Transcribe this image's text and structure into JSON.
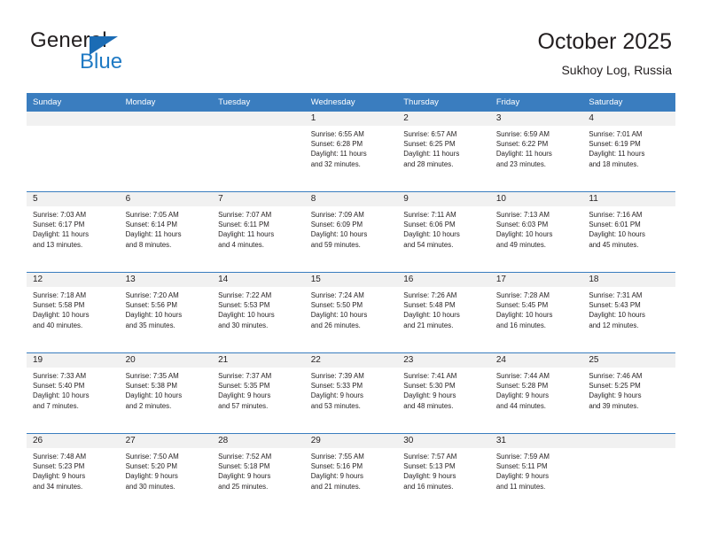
{
  "brand": {
    "name_top": "General",
    "name_bottom": "Blue",
    "triangle_color": "#1b6cb5",
    "blue_color": "#1f7ac4"
  },
  "header": {
    "title": "October 2025",
    "subtitle": "Sukhoy Log, Russia",
    "accent_color": "#3a7dbf",
    "daynum_band_color": "#f1f1f1"
  },
  "weekday_headers": [
    "Sunday",
    "Monday",
    "Tuesday",
    "Wednesday",
    "Thursday",
    "Friday",
    "Saturday"
  ],
  "weeks": [
    [
      {
        "day": "",
        "sunrise": "",
        "sunset": "",
        "daylight_line1": "",
        "daylight_line2": ""
      },
      {
        "day": "",
        "sunrise": "",
        "sunset": "",
        "daylight_line1": "",
        "daylight_line2": ""
      },
      {
        "day": "",
        "sunrise": "",
        "sunset": "",
        "daylight_line1": "",
        "daylight_line2": ""
      },
      {
        "day": "1",
        "sunrise": "Sunrise: 6:55 AM",
        "sunset": "Sunset: 6:28 PM",
        "daylight_line1": "Daylight: 11 hours",
        "daylight_line2": "and 32 minutes."
      },
      {
        "day": "2",
        "sunrise": "Sunrise: 6:57 AM",
        "sunset": "Sunset: 6:25 PM",
        "daylight_line1": "Daylight: 11 hours",
        "daylight_line2": "and 28 minutes."
      },
      {
        "day": "3",
        "sunrise": "Sunrise: 6:59 AM",
        "sunset": "Sunset: 6:22 PM",
        "daylight_line1": "Daylight: 11 hours",
        "daylight_line2": "and 23 minutes."
      },
      {
        "day": "4",
        "sunrise": "Sunrise: 7:01 AM",
        "sunset": "Sunset: 6:19 PM",
        "daylight_line1": "Daylight: 11 hours",
        "daylight_line2": "and 18 minutes."
      }
    ],
    [
      {
        "day": "5",
        "sunrise": "Sunrise: 7:03 AM",
        "sunset": "Sunset: 6:17 PM",
        "daylight_line1": "Daylight: 11 hours",
        "daylight_line2": "and 13 minutes."
      },
      {
        "day": "6",
        "sunrise": "Sunrise: 7:05 AM",
        "sunset": "Sunset: 6:14 PM",
        "daylight_line1": "Daylight: 11 hours",
        "daylight_line2": "and 8 minutes."
      },
      {
        "day": "7",
        "sunrise": "Sunrise: 7:07 AM",
        "sunset": "Sunset: 6:11 PM",
        "daylight_line1": "Daylight: 11 hours",
        "daylight_line2": "and 4 minutes."
      },
      {
        "day": "8",
        "sunrise": "Sunrise: 7:09 AM",
        "sunset": "Sunset: 6:09 PM",
        "daylight_line1": "Daylight: 10 hours",
        "daylight_line2": "and 59 minutes."
      },
      {
        "day": "9",
        "sunrise": "Sunrise: 7:11 AM",
        "sunset": "Sunset: 6:06 PM",
        "daylight_line1": "Daylight: 10 hours",
        "daylight_line2": "and 54 minutes."
      },
      {
        "day": "10",
        "sunrise": "Sunrise: 7:13 AM",
        "sunset": "Sunset: 6:03 PM",
        "daylight_line1": "Daylight: 10 hours",
        "daylight_line2": "and 49 minutes."
      },
      {
        "day": "11",
        "sunrise": "Sunrise: 7:16 AM",
        "sunset": "Sunset: 6:01 PM",
        "daylight_line1": "Daylight: 10 hours",
        "daylight_line2": "and 45 minutes."
      }
    ],
    [
      {
        "day": "12",
        "sunrise": "Sunrise: 7:18 AM",
        "sunset": "Sunset: 5:58 PM",
        "daylight_line1": "Daylight: 10 hours",
        "daylight_line2": "and 40 minutes."
      },
      {
        "day": "13",
        "sunrise": "Sunrise: 7:20 AM",
        "sunset": "Sunset: 5:56 PM",
        "daylight_line1": "Daylight: 10 hours",
        "daylight_line2": "and 35 minutes."
      },
      {
        "day": "14",
        "sunrise": "Sunrise: 7:22 AM",
        "sunset": "Sunset: 5:53 PM",
        "daylight_line1": "Daylight: 10 hours",
        "daylight_line2": "and 30 minutes."
      },
      {
        "day": "15",
        "sunrise": "Sunrise: 7:24 AM",
        "sunset": "Sunset: 5:50 PM",
        "daylight_line1": "Daylight: 10 hours",
        "daylight_line2": "and 26 minutes."
      },
      {
        "day": "16",
        "sunrise": "Sunrise: 7:26 AM",
        "sunset": "Sunset: 5:48 PM",
        "daylight_line1": "Daylight: 10 hours",
        "daylight_line2": "and 21 minutes."
      },
      {
        "day": "17",
        "sunrise": "Sunrise: 7:28 AM",
        "sunset": "Sunset: 5:45 PM",
        "daylight_line1": "Daylight: 10 hours",
        "daylight_line2": "and 16 minutes."
      },
      {
        "day": "18",
        "sunrise": "Sunrise: 7:31 AM",
        "sunset": "Sunset: 5:43 PM",
        "daylight_line1": "Daylight: 10 hours",
        "daylight_line2": "and 12 minutes."
      }
    ],
    [
      {
        "day": "19",
        "sunrise": "Sunrise: 7:33 AM",
        "sunset": "Sunset: 5:40 PM",
        "daylight_line1": "Daylight: 10 hours",
        "daylight_line2": "and 7 minutes."
      },
      {
        "day": "20",
        "sunrise": "Sunrise: 7:35 AM",
        "sunset": "Sunset: 5:38 PM",
        "daylight_line1": "Daylight: 10 hours",
        "daylight_line2": "and 2 minutes."
      },
      {
        "day": "21",
        "sunrise": "Sunrise: 7:37 AM",
        "sunset": "Sunset: 5:35 PM",
        "daylight_line1": "Daylight: 9 hours",
        "daylight_line2": "and 57 minutes."
      },
      {
        "day": "22",
        "sunrise": "Sunrise: 7:39 AM",
        "sunset": "Sunset: 5:33 PM",
        "daylight_line1": "Daylight: 9 hours",
        "daylight_line2": "and 53 minutes."
      },
      {
        "day": "23",
        "sunrise": "Sunrise: 7:41 AM",
        "sunset": "Sunset: 5:30 PM",
        "daylight_line1": "Daylight: 9 hours",
        "daylight_line2": "and 48 minutes."
      },
      {
        "day": "24",
        "sunrise": "Sunrise: 7:44 AM",
        "sunset": "Sunset: 5:28 PM",
        "daylight_line1": "Daylight: 9 hours",
        "daylight_line2": "and 44 minutes."
      },
      {
        "day": "25",
        "sunrise": "Sunrise: 7:46 AM",
        "sunset": "Sunset: 5:25 PM",
        "daylight_line1": "Daylight: 9 hours",
        "daylight_line2": "and 39 minutes."
      }
    ],
    [
      {
        "day": "26",
        "sunrise": "Sunrise: 7:48 AM",
        "sunset": "Sunset: 5:23 PM",
        "daylight_line1": "Daylight: 9 hours",
        "daylight_line2": "and 34 minutes."
      },
      {
        "day": "27",
        "sunrise": "Sunrise: 7:50 AM",
        "sunset": "Sunset: 5:20 PM",
        "daylight_line1": "Daylight: 9 hours",
        "daylight_line2": "and 30 minutes."
      },
      {
        "day": "28",
        "sunrise": "Sunrise: 7:52 AM",
        "sunset": "Sunset: 5:18 PM",
        "daylight_line1": "Daylight: 9 hours",
        "daylight_line2": "and 25 minutes."
      },
      {
        "day": "29",
        "sunrise": "Sunrise: 7:55 AM",
        "sunset": "Sunset: 5:16 PM",
        "daylight_line1": "Daylight: 9 hours",
        "daylight_line2": "and 21 minutes."
      },
      {
        "day": "30",
        "sunrise": "Sunrise: 7:57 AM",
        "sunset": "Sunset: 5:13 PM",
        "daylight_line1": "Daylight: 9 hours",
        "daylight_line2": "and 16 minutes."
      },
      {
        "day": "31",
        "sunrise": "Sunrise: 7:59 AM",
        "sunset": "Sunset: 5:11 PM",
        "daylight_line1": "Daylight: 9 hours",
        "daylight_line2": "and 11 minutes."
      },
      {
        "day": "",
        "sunrise": "",
        "sunset": "",
        "daylight_line1": "",
        "daylight_line2": ""
      }
    ]
  ]
}
